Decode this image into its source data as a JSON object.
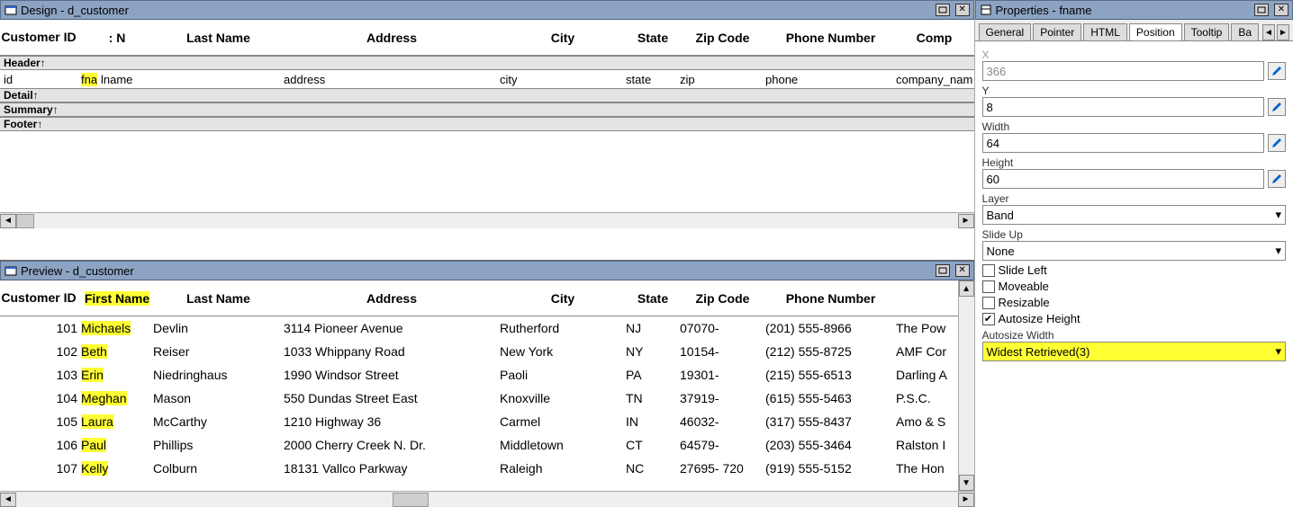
{
  "design": {
    "title": "Design - d_customer",
    "columns": [
      "Customer ID",
      ": N",
      "Last Name",
      "Address",
      "City",
      "State",
      "Zip Code",
      "Phone Number",
      "Comp"
    ],
    "bands": {
      "header": "Header↑",
      "detail": "Detail↑",
      "summary": "Summary↑",
      "footer": "Footer↑"
    },
    "fields": {
      "id": "id",
      "fn": "fna",
      "ln": "lname",
      "addr": "address",
      "city": "city",
      "st": "state",
      "zip": "zip",
      "ph": "phone",
      "co": "company_nam"
    }
  },
  "preview": {
    "title": "Preview - d_customer",
    "columns": [
      "Customer ID",
      "First Name",
      "Last Name",
      "Address",
      "City",
      "State",
      "Zip Code",
      "Phone Number",
      ""
    ],
    "rows": [
      {
        "id": 101,
        "fn": "Michaels",
        "ln": "Devlin",
        "addr": "3114 Pioneer Avenue",
        "city": "Rutherford",
        "st": "NJ",
        "zip": "07070-",
        "ph": "(201) 555-8966",
        "co": "The Pow"
      },
      {
        "id": 102,
        "fn": "Beth",
        "ln": "Reiser",
        "addr": "1033 Whippany Road",
        "city": "New York",
        "st": "NY",
        "zip": "10154-",
        "ph": "(212) 555-8725",
        "co": "AMF Cor"
      },
      {
        "id": 103,
        "fn": "Erin",
        "ln": "Niedringhaus",
        "addr": "1990 Windsor Street",
        "city": "Paoli",
        "st": "PA",
        "zip": "19301-",
        "ph": "(215) 555-6513",
        "co": "Darling A"
      },
      {
        "id": 104,
        "fn": "Meghan",
        "ln": "Mason",
        "addr": "550 Dundas Street East",
        "city": "Knoxville",
        "st": "TN",
        "zip": "37919-",
        "ph": "(615) 555-5463",
        "co": "P.S.C."
      },
      {
        "id": 105,
        "fn": "Laura",
        "ln": "McCarthy",
        "addr": "1210 Highway 36",
        "city": "Carmel",
        "st": "IN",
        "zip": "46032-",
        "ph": "(317) 555-8437",
        "co": "Amo & S"
      },
      {
        "id": 106,
        "fn": "Paul",
        "ln": "Phillips",
        "addr": "2000 Cherry Creek N. Dr.",
        "city": "Middletown",
        "st": "CT",
        "zip": "64579-",
        "ph": "(203) 555-3464",
        "co": "Ralston I"
      },
      {
        "id": 107,
        "fn": "Kelly",
        "ln": "Colburn",
        "addr": "18131 Vallco Parkway",
        "city": "Raleigh",
        "st": "NC",
        "zip": "27695- 720",
        "ph": "(919) 555-5152",
        "co": "The Hon"
      }
    ]
  },
  "properties": {
    "title": "Properties - fname",
    "tabs": [
      "General",
      "Pointer",
      "HTML",
      "Position",
      "Tooltip",
      "Ba"
    ],
    "active_tab": "Position",
    "fields": {
      "x_label": "X",
      "x": "366",
      "y_label": "Y",
      "y": "8",
      "width_label": "Width",
      "width": "64",
      "height_label": "Height",
      "height": "60",
      "layer_label": "Layer",
      "layer": "Band",
      "slideup_label": "Slide Up",
      "slideup": "None",
      "slide_left": "Slide Left",
      "moveable": "Moveable",
      "resizable": "Resizable",
      "autosize_h": "Autosize Height",
      "autosize_w_label": "Autosize Width",
      "autosize_w": "Widest Retrieved(3)"
    }
  }
}
